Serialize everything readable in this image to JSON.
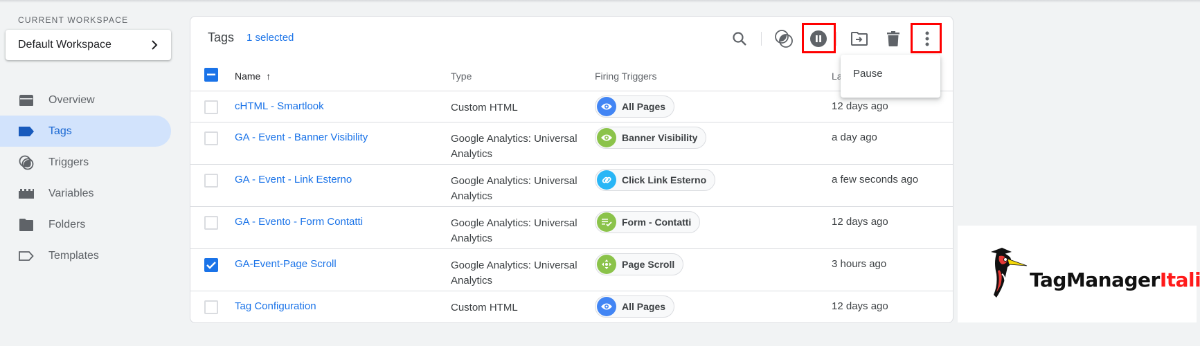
{
  "sidebar": {
    "workspace_label": "CURRENT WORKSPACE",
    "workspace_name": "Default Workspace",
    "items": [
      {
        "label": "Overview",
        "icon": "overview-icon",
        "active": false
      },
      {
        "label": "Tags",
        "icon": "tag-icon",
        "active": true
      },
      {
        "label": "Triggers",
        "icon": "trigger-icon",
        "active": false
      },
      {
        "label": "Variables",
        "icon": "variables-icon",
        "active": false
      },
      {
        "label": "Folders",
        "icon": "folder-icon",
        "active": false
      },
      {
        "label": "Templates",
        "icon": "template-icon",
        "active": false
      }
    ]
  },
  "card": {
    "title": "Tags",
    "selected_count": "1 selected",
    "toolbar": [
      {
        "name": "search",
        "icon": "search-icon"
      },
      {
        "name": "change-triggers",
        "icon": "trigger-icon"
      },
      {
        "name": "pause",
        "icon": "pause-circle-icon",
        "highlighted": true
      },
      {
        "name": "move-to-folder",
        "icon": "move-to-folder-icon"
      },
      {
        "name": "delete",
        "icon": "trash-icon"
      },
      {
        "name": "more",
        "icon": "more-vert-icon",
        "highlighted": true
      }
    ],
    "columns": {
      "name": "Name",
      "sort_indicator": "↑",
      "type": "Type",
      "triggers": "Firing Triggers",
      "last_edited": "Last Edited"
    },
    "menu": {
      "items": [
        "Pause"
      ]
    },
    "rows": [
      {
        "name": "cHTML - Smartlook",
        "type": "Custom HTML",
        "trigger": "All Pages",
        "trigger_icon": "eye-icon",
        "trigger_color": "#4285f4",
        "edited": "12 days ago",
        "checked": false
      },
      {
        "name": "GA - Event - Banner Visibility",
        "type": "Google Analytics: Universal Analytics",
        "trigger": "Banner Visibility",
        "trigger_icon": "eye-icon",
        "trigger_color": "#8bc34a",
        "edited": "a day ago",
        "checked": false
      },
      {
        "name": "GA - Event - Link Esterno",
        "type": "Google Analytics: Universal Analytics",
        "trigger": "Click Link Esterno",
        "trigger_icon": "link-icon",
        "trigger_color": "#29b6f6",
        "edited": "a few seconds ago",
        "checked": false
      },
      {
        "name": "GA - Evento - Form Contatti",
        "type": "Google Analytics: Universal Analytics",
        "trigger": "Form - Contatti",
        "trigger_icon": "form-check-icon",
        "trigger_color": "#8bc34a",
        "edited": "12 days ago",
        "checked": false
      },
      {
        "name": "GA-Event-Page Scroll",
        "type": "Google Analytics: Universal Analytics",
        "trigger": "Page Scroll",
        "trigger_icon": "scroll-arrows-icon",
        "trigger_color": "#8bc34a",
        "edited": "3 hours ago",
        "checked": true
      },
      {
        "name": "Tag Configuration",
        "type": "Custom HTML",
        "trigger": "All Pages",
        "trigger_icon": "eye-icon",
        "trigger_color": "#4285f4",
        "edited": "12 days ago",
        "checked": false
      }
    ]
  },
  "logo": {
    "text_main": "TagManager",
    "text_accent": "Italia"
  },
  "colors": {
    "accent": "#1a73e8",
    "active_nav_bg": "#d2e3fc",
    "highlight_frame": "#ff0000"
  }
}
